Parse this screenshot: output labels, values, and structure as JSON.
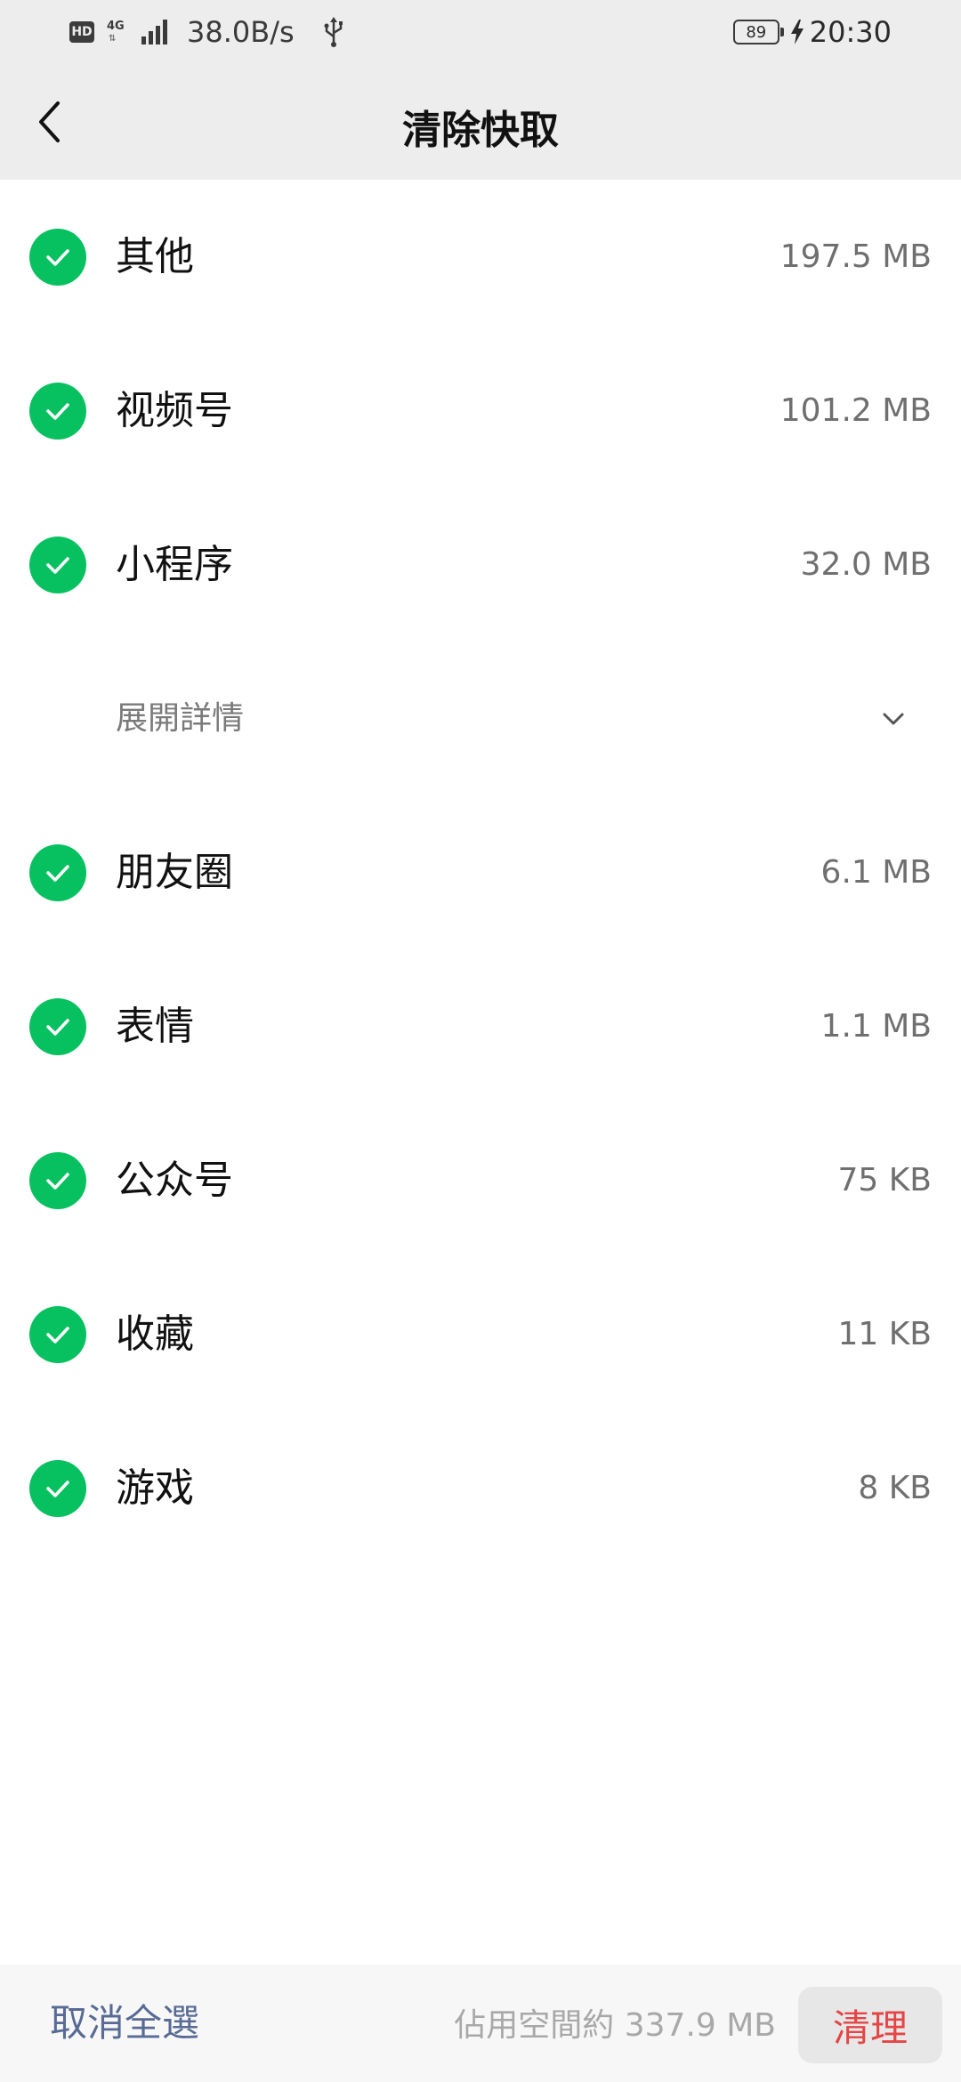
{
  "status_bar": {
    "hd_badge": "HD",
    "network_type": "4G",
    "network_speed": "38.0B/s",
    "battery_level": "89",
    "time": "20:30"
  },
  "header": {
    "title": "清除快取"
  },
  "cache_items_top": [
    {
      "label": "其他",
      "size": "197.5 MB",
      "checked": true
    },
    {
      "label": "视频号",
      "size": "101.2 MB",
      "checked": true
    },
    {
      "label": "小程序",
      "size": "32.0 MB",
      "checked": true
    }
  ],
  "expand": {
    "label": "展開詳情"
  },
  "cache_items_bottom": [
    {
      "label": "朋友圈",
      "size": "6.1 MB",
      "checked": true
    },
    {
      "label": "表情",
      "size": "1.1 MB",
      "checked": true
    },
    {
      "label": "公众号",
      "size": "75 KB",
      "checked": true
    },
    {
      "label": "收藏",
      "size": "11 KB",
      "checked": true
    },
    {
      "label": "游戏",
      "size": "8 KB",
      "checked": true
    }
  ],
  "footer": {
    "deselect_all_label": "取消全選",
    "usage_text": "佔用空間約 337.9 MB",
    "clean_label": "清理"
  },
  "colors": {
    "check_green": "#07c160",
    "link_blue": "#576b95",
    "danger_red": "#e54545",
    "header_bg": "#ededed"
  },
  "icons": {
    "back": "chevron-left-icon",
    "check": "check-circle-icon",
    "expand": "chevron-down-icon",
    "usb": "usb-icon",
    "charging": "lightning-bolt-icon"
  }
}
